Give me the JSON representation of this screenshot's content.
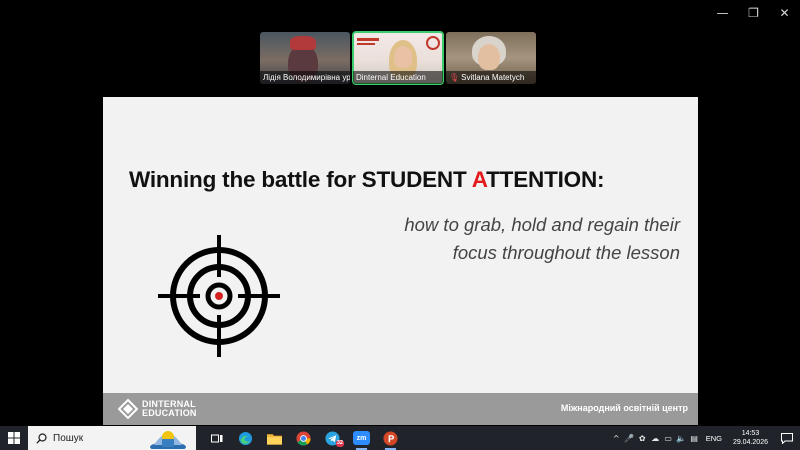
{
  "window_controls": {
    "minimize": "—",
    "restore": "❐",
    "close": "✕"
  },
  "participants": [
    {
      "name": "Лідія Володимирівна ур...",
      "muted": false,
      "active": false
    },
    {
      "name": "Dinternal Education",
      "muted": false,
      "active": true
    },
    {
      "name": "Svitlana Matetych",
      "muted": true,
      "active": false
    }
  ],
  "slide": {
    "title_part1": "Winning the battle for STUDENT ",
    "title_red": "A",
    "title_part2": "TTENTION:",
    "subtitle_line1": "how to grab, hold and regain their",
    "subtitle_line2": "focus throughout the lesson",
    "logo_line1": "DINTERNAL",
    "logo_line2": "EDUCATION",
    "footer_right": "Міжнародний освітній центр",
    "accent_color": "#e31b1b"
  },
  "taskbar": {
    "search_placeholder": "Пошук",
    "apps": [
      {
        "icon": "task-view-icon"
      },
      {
        "icon": "edge-icon"
      },
      {
        "icon": "file-explorer-icon"
      },
      {
        "icon": "chrome-icon"
      },
      {
        "icon": "telegram-icon",
        "badge": "32"
      },
      {
        "icon": "zoom-icon",
        "label": "zm"
      },
      {
        "icon": "presentation-icon"
      }
    ],
    "language": "ENG",
    "time": "14:53",
    "date": "29.04.2026"
  }
}
